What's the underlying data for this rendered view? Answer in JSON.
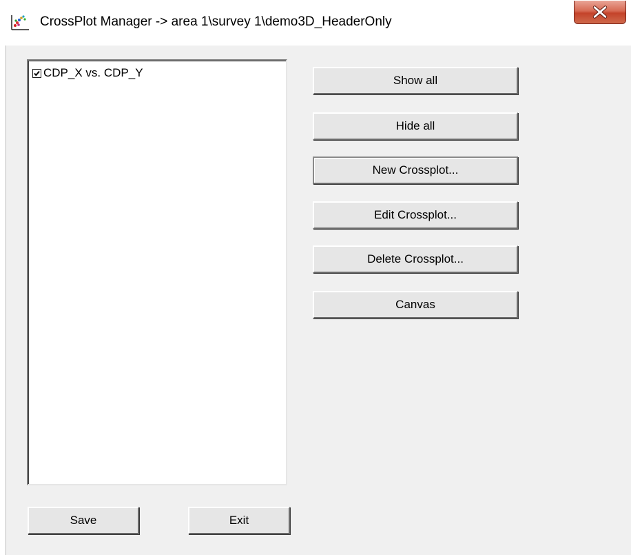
{
  "window": {
    "title": "CrossPlot Manager -> area 1\\survey 1\\demo3D_HeaderOnly",
    "close_icon": "close-x-icon"
  },
  "list": {
    "items": [
      {
        "label": "CDP_X vs. CDP_Y",
        "checked": true
      }
    ]
  },
  "actions": {
    "show_all": "Show all",
    "hide_all": "Hide all",
    "new_crossplot": "New Crossplot...",
    "edit_crossplot": "Edit Crossplot...",
    "delete_crossplot": "Delete Crossplot...",
    "canvas": "Canvas"
  },
  "footer": {
    "save": "Save",
    "exit": "Exit"
  },
  "colors": {
    "dialog_bg": "#f0f0f0",
    "close_button": "#c4432a"
  }
}
